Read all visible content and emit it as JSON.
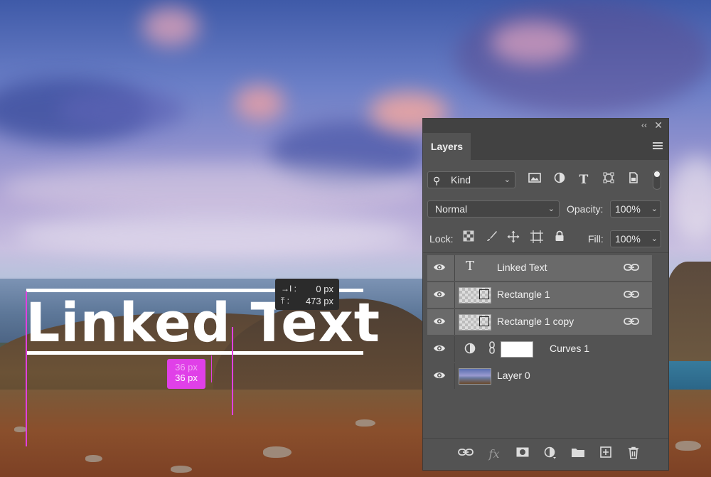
{
  "canvas": {
    "text": "Linked Text",
    "measure": {
      "top": "36 px",
      "bottom": "36 px"
    },
    "tooltip": {
      "dx_label": "→I :",
      "dx": "0 px",
      "dy_label": "⤒ :",
      "dy": "473 px"
    }
  },
  "panel": {
    "collapse": "‹‹",
    "close": "✕",
    "tab": "Layers",
    "filter": {
      "kind": "Kind",
      "icons": [
        "image-filter-icon",
        "adjustment-filter-icon",
        "type-filter-icon",
        "shape-filter-icon",
        "smart-object-filter-icon"
      ]
    },
    "blend_mode": "Normal",
    "opacity_label": "Opacity:",
    "opacity": "100%",
    "lock_label": "Lock:",
    "fill_label": "Fill:",
    "fill": "100%",
    "layers": [
      {
        "name": "Linked Text",
        "kind": "type",
        "linked": true,
        "selected": true
      },
      {
        "name": "Rectangle 1",
        "kind": "shape",
        "linked": true,
        "selected": true
      },
      {
        "name": "Rectangle 1 copy",
        "kind": "shape",
        "linked": true,
        "selected": true
      },
      {
        "name": "Curves 1",
        "kind": "adjustment",
        "linked": false,
        "selected": false
      },
      {
        "name": "Layer 0",
        "kind": "pixel",
        "linked": false,
        "selected": false
      }
    ],
    "bottom_icons": [
      "link-layers-icon",
      "fx-icon",
      "mask-icon",
      "adjustment-icon",
      "group-folder-icon",
      "new-layer-icon",
      "trash-icon"
    ],
    "type_glyph": "T",
    "fx_glyph": "fx"
  },
  "colors": {
    "guide": "#e040e0",
    "panel": "#535353",
    "selected_row": "#6a6a6a"
  }
}
